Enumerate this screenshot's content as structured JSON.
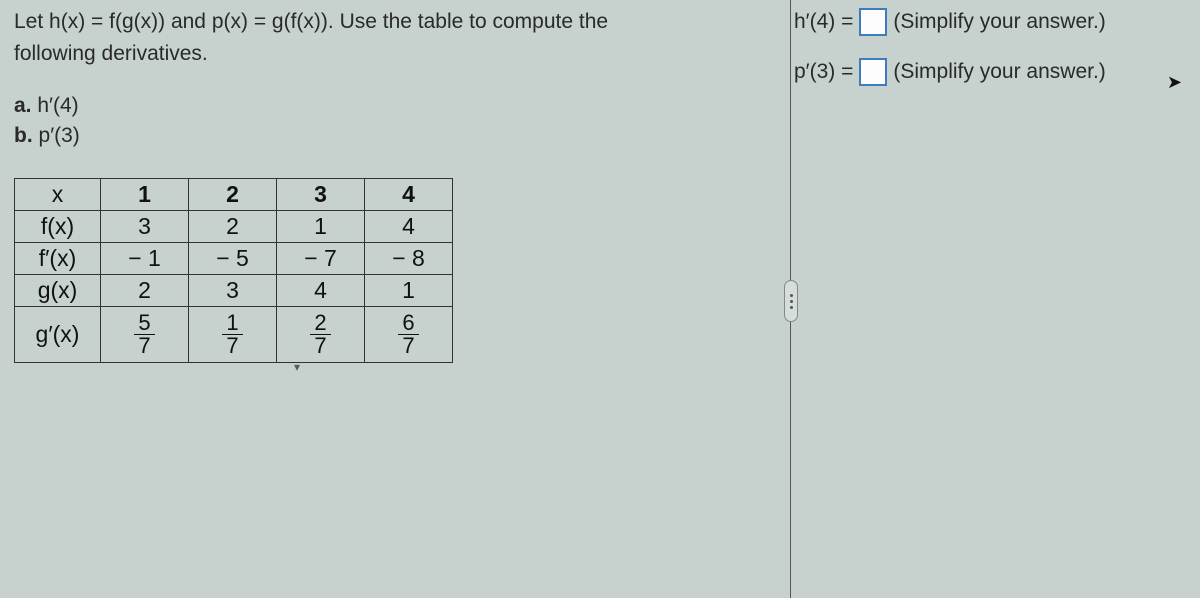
{
  "prompt": {
    "line1": "Let h(x) = f(g(x)) and p(x) = g(f(x)). Use the table to compute the",
    "line2": "following derivatives.",
    "part_a_label": "a.",
    "part_a_expr": "h′(4)",
    "part_b_label": "b.",
    "part_b_expr": "p′(3)"
  },
  "table": {
    "row_labels": [
      "x",
      "f(x)",
      "f′(x)",
      "g(x)",
      "g′(x)"
    ],
    "cols": [
      "1",
      "2",
      "3",
      "4"
    ],
    "f": [
      "3",
      "2",
      "1",
      "4"
    ],
    "fp": [
      "− 1",
      "− 5",
      "− 7",
      "− 8"
    ],
    "g": [
      "2",
      "3",
      "4",
      "1"
    ],
    "gp_num": [
      "5",
      "1",
      "2",
      "6"
    ],
    "gp_den": [
      "7",
      "7",
      "7",
      "7"
    ]
  },
  "answers": {
    "a_label": "h′(4) =",
    "b_label": "p′(3) =",
    "hint": "(Simplify your answer.)"
  }
}
